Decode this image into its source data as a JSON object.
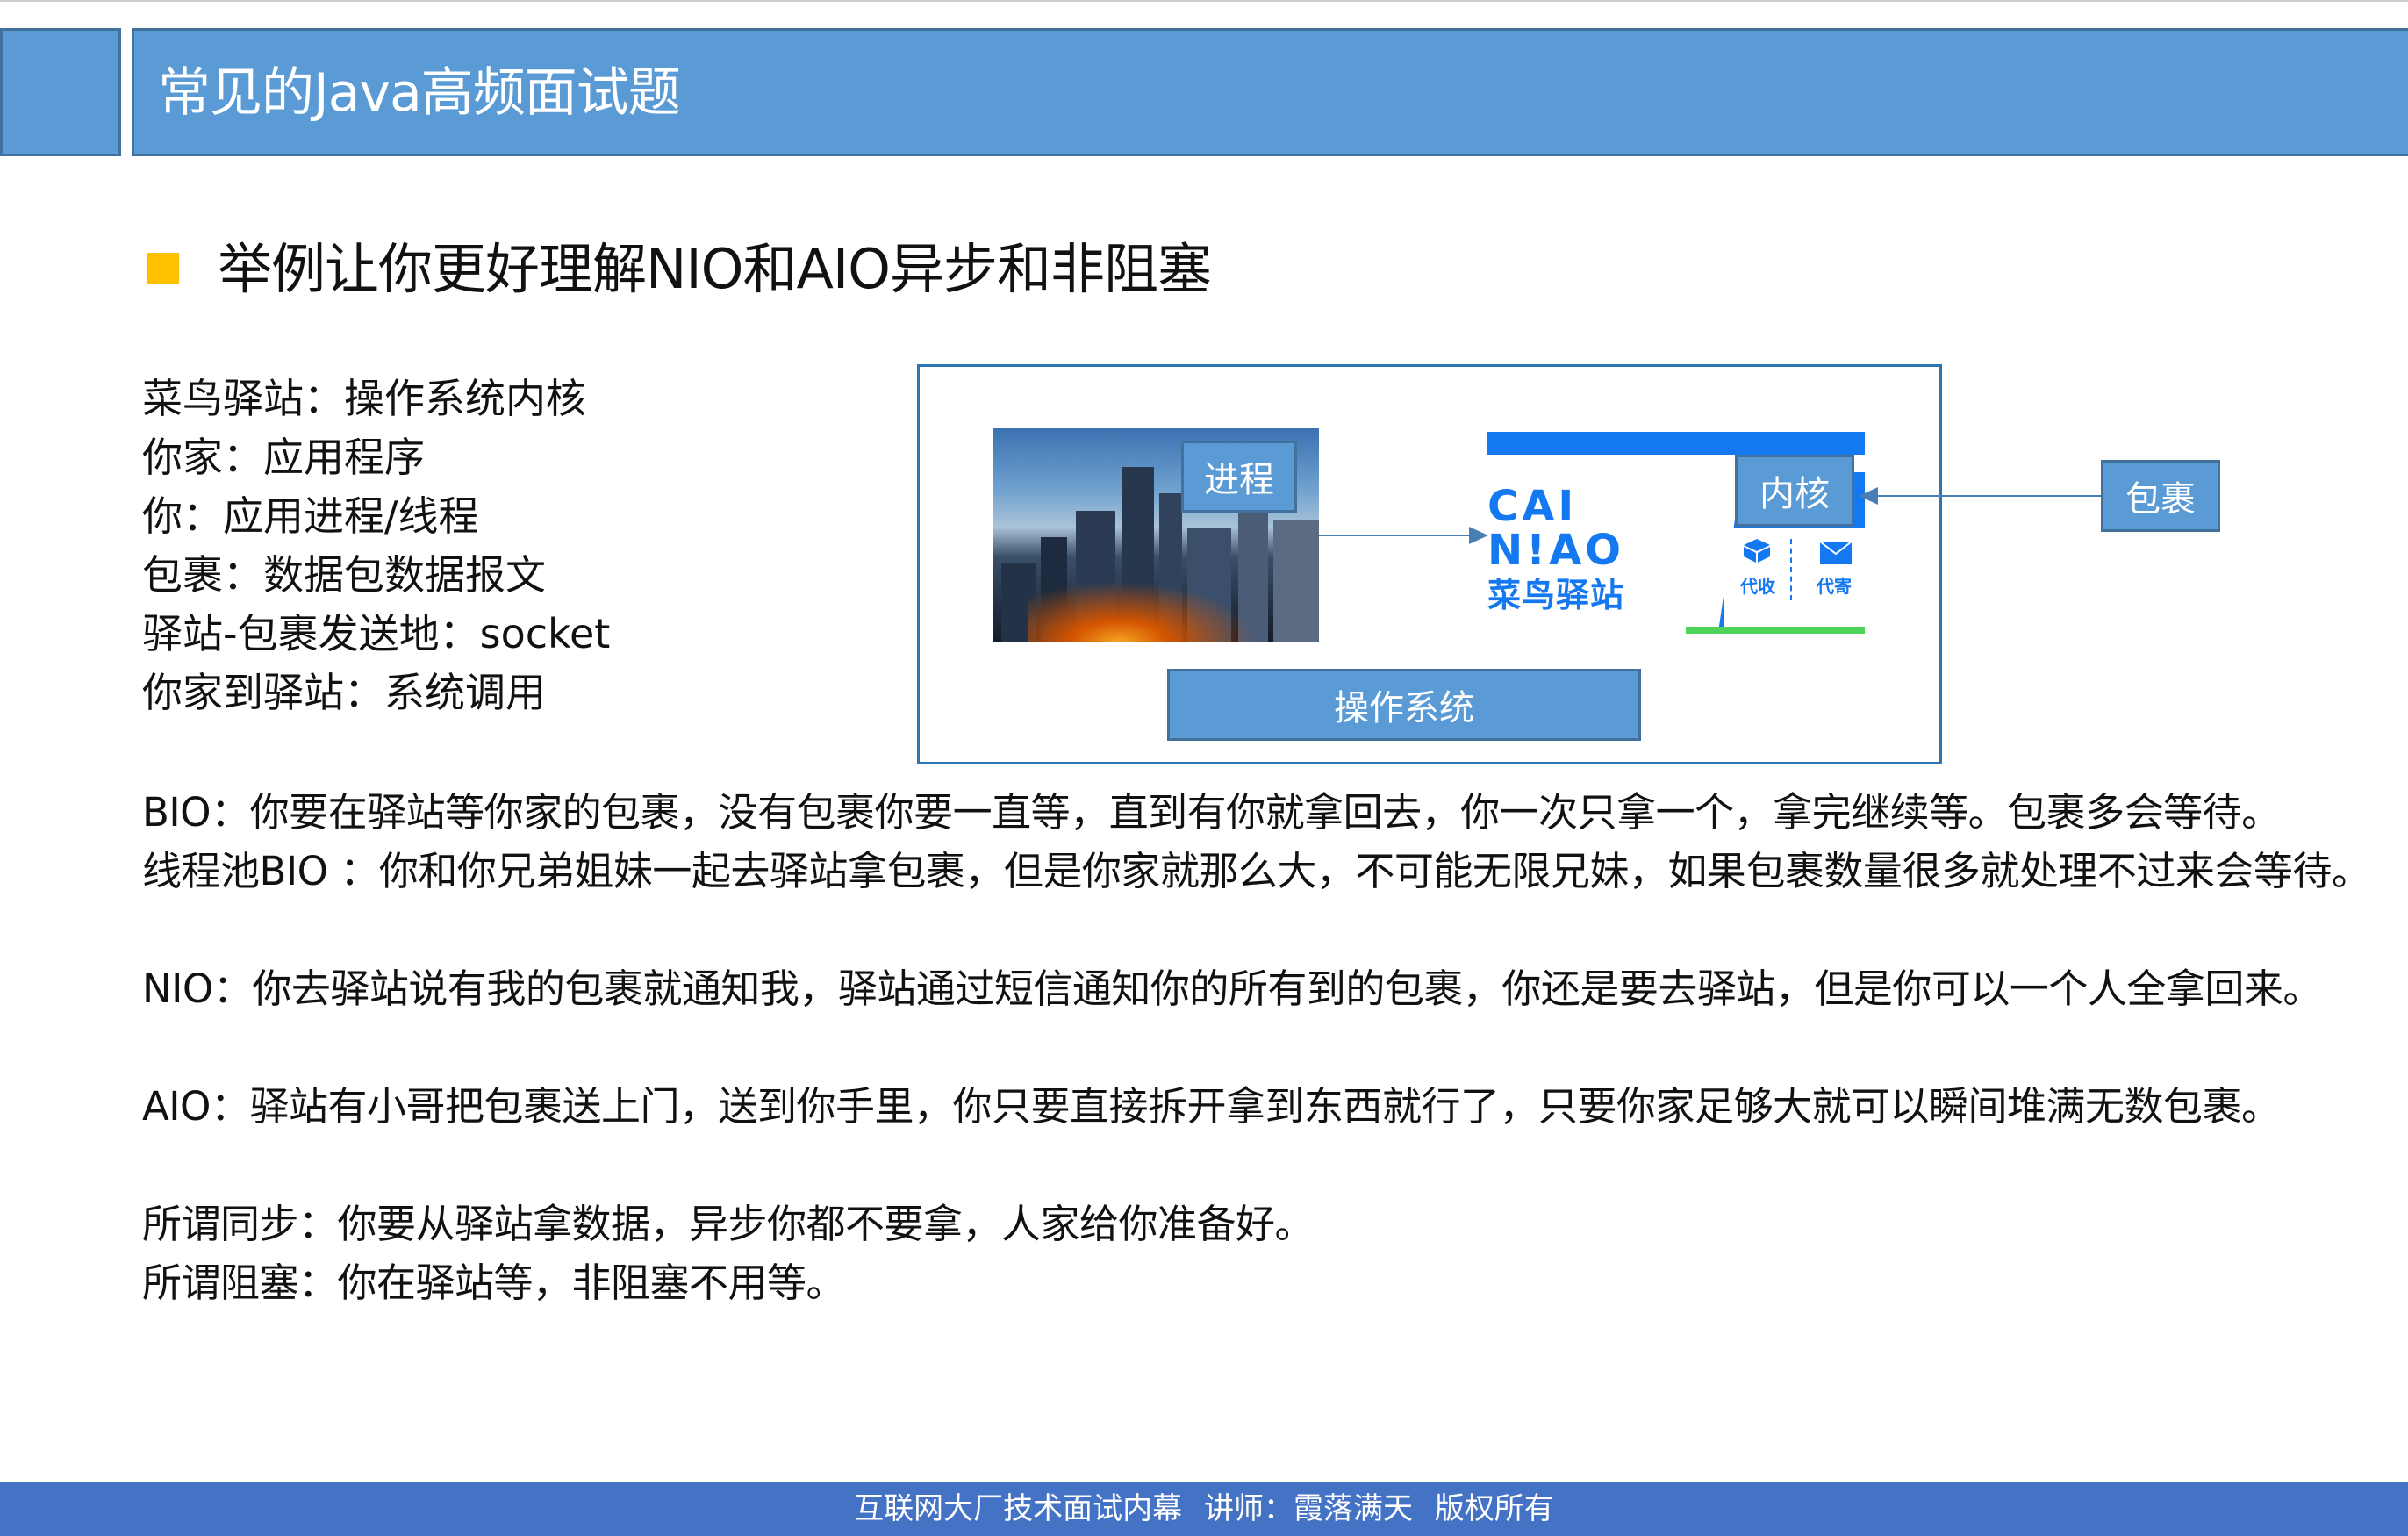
{
  "header": {
    "title": "常见的Java高频面试题"
  },
  "subtitle": "举例让你更好理解NIO和AIO异步和非阻塞",
  "definitions": [
    "菜鸟驿站：操作系统内核",
    "你家：应用程序",
    "你：应用进程/线程",
    "包裹：数据包数据报文",
    "驿站-包裹发送地：socket",
    "你家到驿站：系统调用"
  ],
  "diagram": {
    "process_label": "进程",
    "kernel_label": "内核",
    "package_label": "包裹",
    "os_label": "操作系统",
    "logo_en_top": "CAI",
    "logo_en_bottom": "N!AO",
    "logo_zh": "菜鸟驿站",
    "tag_collect": "代收",
    "tag_send": "代寄",
    "brand_color": "#1478f0"
  },
  "paragraphs": {
    "bio": "BIO：你要在驿站等你家的包裹，没有包裹你要一直等，直到有你就拿回去，你一次只拿一个，拿完继续等。包裹多会等待。",
    "bio_pool": "线程池BIO ：你和你兄弟姐妹一起去驿站拿包裹，但是你家就那么大，不可能无限兄妹，如果包裹数量很多就处理不过来会等待。",
    "nio": "NIO：你去驿站说有我的包裹就通知我，驿站通过短信通知你的所有到的包裹，你还是要去驿站，但是你可以一个人全拿回来。",
    "aio": "AIO：驿站有小哥把包裹送上门，送到你手里，你只要直接拆开拿到东西就行了，只要你家足够大就可以瞬间堆满无数包裹。",
    "sync": "所谓同步：你要从驿站拿数据，异步你都不要拿，人家给你准备好。",
    "block": "所谓阻塞：你在驿站等，非阻塞不用等。"
  },
  "footer": {
    "text": "互联网大厂技术面试内幕   讲师：霞落满天   版权所有"
  },
  "colors": {
    "header": "#5b9bd5",
    "bullet": "#ffc000",
    "footer": "#4472c4"
  }
}
